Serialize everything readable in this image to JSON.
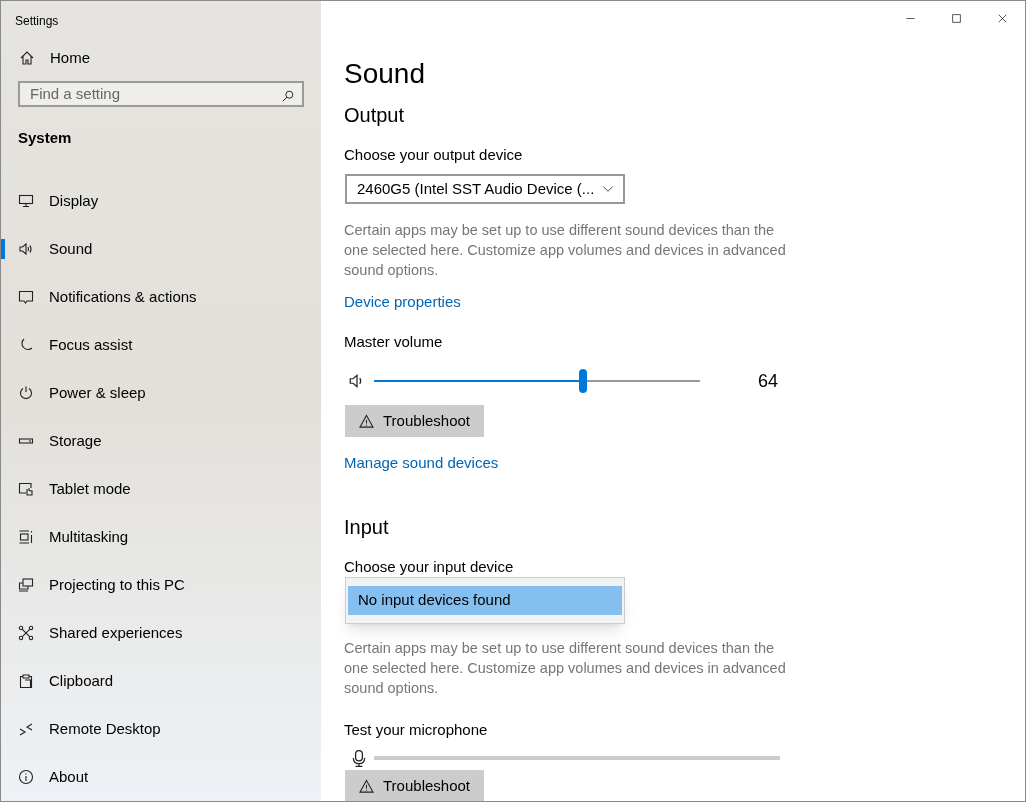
{
  "window": {
    "title": "Settings"
  },
  "sidebar": {
    "home": "Home",
    "search": {
      "placeholder": "Find a setting"
    },
    "section": "System",
    "items": [
      {
        "label": "Display",
        "selected": false
      },
      {
        "label": "Sound",
        "selected": true
      },
      {
        "label": "Notifications & actions",
        "selected": false
      },
      {
        "label": "Focus assist",
        "selected": false
      },
      {
        "label": "Power & sleep",
        "selected": false
      },
      {
        "label": "Storage",
        "selected": false
      },
      {
        "label": "Tablet mode",
        "selected": false
      },
      {
        "label": "Multitasking",
        "selected": false
      },
      {
        "label": "Projecting to this PC",
        "selected": false
      },
      {
        "label": "Shared experiences",
        "selected": false
      },
      {
        "label": "Clipboard",
        "selected": false
      },
      {
        "label": "Remote Desktop",
        "selected": false
      },
      {
        "label": "About",
        "selected": false
      }
    ]
  },
  "page": {
    "title": "Sound",
    "output": {
      "heading": "Output",
      "device_label": "Choose your output device",
      "device_value": "2460G5 (Intel SST Audio Device (...",
      "help": "Certain apps may be set up to use different sound devices than the one selected here. Customize app volumes and devices in advanced sound options.",
      "properties_link": "Device properties",
      "volume_label": "Master volume",
      "volume": {
        "level": 0.64,
        "reading": "64"
      },
      "troubleshoot": "Troubleshoot",
      "manage_link": "Manage sound devices"
    },
    "input": {
      "heading": "Input",
      "device_label": "Choose your input device",
      "device_options": [
        {
          "label": "No input devices found",
          "selected": true
        }
      ],
      "help": "Certain apps may be set up to use different sound devices than the one selected here. Customize app volumes and devices in advanced sound options.",
      "test_label": "Test your microphone",
      "troubleshoot": "Troubleshoot"
    }
  }
}
